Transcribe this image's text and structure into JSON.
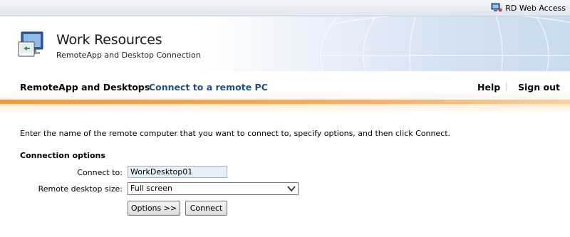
{
  "topbar": {
    "brand_label": "RD Web Access",
    "icon": "rd-web-access-icon"
  },
  "header": {
    "title": "Work Resources",
    "subtitle": "RemoteApp and Desktop Connection",
    "logo_icon": "remote-desktop-computer-icon"
  },
  "nav": {
    "tabs": [
      {
        "label": "RemoteApp and Desktops",
        "active": false
      },
      {
        "label": "Connect to a remote PC",
        "active": true
      }
    ],
    "separator": "|",
    "help_label": "Help",
    "signout_label": "Sign out"
  },
  "accent_color": "#f39a33",
  "active_tab_color": "#1e4f86",
  "main": {
    "instructions": "Enter the name of the remote computer that you want to connect to, specify options, and then click Connect.",
    "section_title": "Connection options",
    "connect_to_label": "Connect to:",
    "connect_to_value": "WorkDesktop01",
    "size_label": "Remote desktop size:",
    "size_selected": "Full screen",
    "options_button": "Options >>",
    "connect_button": "Connect"
  }
}
